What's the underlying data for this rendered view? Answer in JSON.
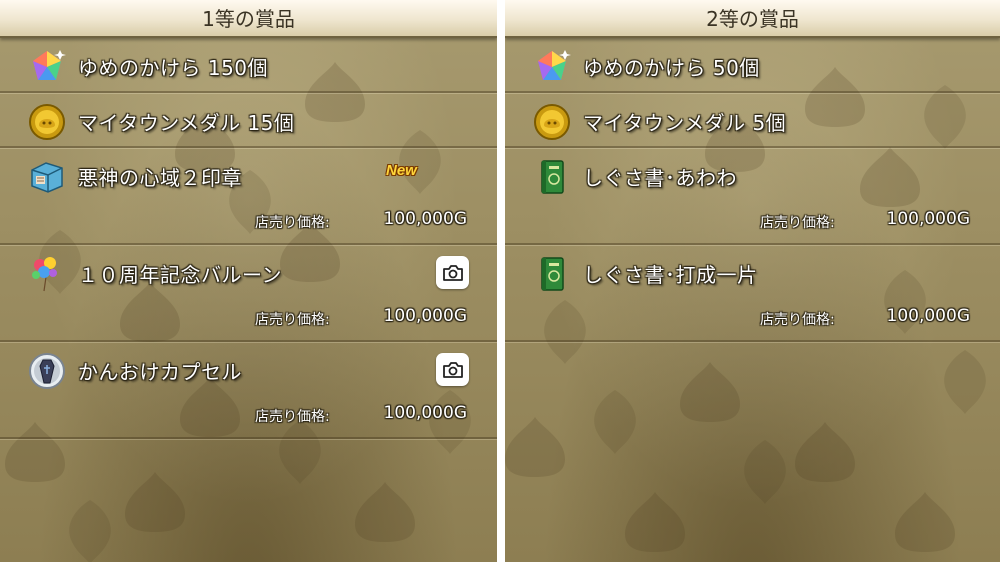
{
  "left_panel": {
    "title": "1等の賞品",
    "items": [
      {
        "name": "ゆめのかけら 150個",
        "icon": "dream-fragment-icon"
      },
      {
        "name": "マイタウンメダル 15個",
        "icon": "mytown-medal-icon"
      },
      {
        "name": "悪神の心域２印章",
        "icon": "seal-box-icon",
        "badge": "New",
        "price_label": "店売り価格:",
        "price": "100,000G"
      },
      {
        "name": "１０周年記念バルーン",
        "icon": "balloon-icon",
        "action": "camera-icon",
        "price_label": "店売り価格:",
        "price": "100,000G"
      },
      {
        "name": "かんおけカプセル",
        "icon": "coffin-capsule-icon",
        "action": "camera-icon",
        "price_label": "店売り価格:",
        "price": "100,000G"
      }
    ]
  },
  "right_panel": {
    "title": "2等の賞品",
    "items": [
      {
        "name": "ゆめのかけら 50個",
        "icon": "dream-fragment-icon"
      },
      {
        "name": "マイタウンメダル 5個",
        "icon": "mytown-medal-icon"
      },
      {
        "name": "しぐさ書･あわわ",
        "icon": "gesture-book-icon",
        "price_label": "店売り価格:",
        "price": "100,000G"
      },
      {
        "name": "しぐさ書･打成一片",
        "icon": "gesture-book-icon",
        "price_label": "店売り価格:",
        "price": "100,000G"
      }
    ]
  },
  "colors": {
    "panel_bg": "#9d8f63",
    "header_bg": "#efe6cf",
    "text": "#ffffff",
    "new_badge": "#ffd53a"
  }
}
